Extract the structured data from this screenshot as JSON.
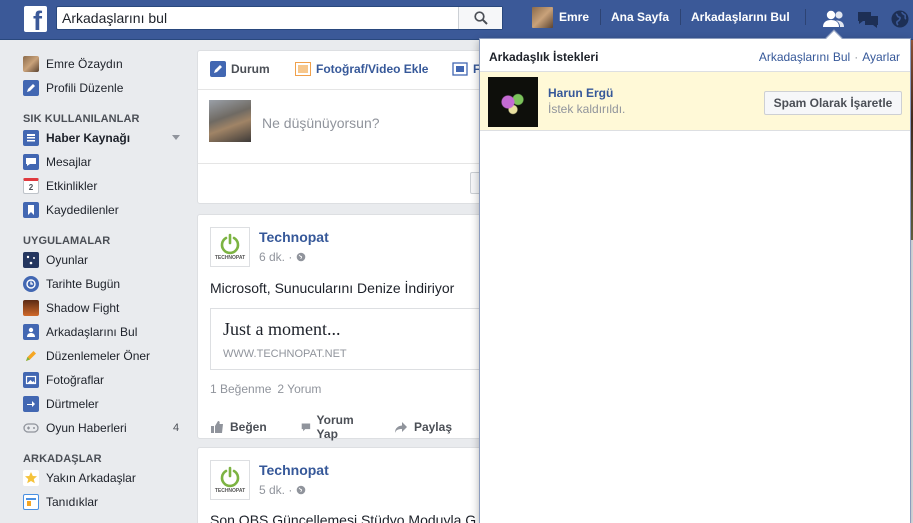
{
  "topbar": {
    "search_placeholder": "Arkadaşlarını bul",
    "search_value": "Arkadaşlarını bul",
    "user_name": "Emre",
    "home": "Ana Sayfa",
    "find_friends": "Arkadaşlarını Bul",
    "icons": [
      "search-icon",
      "friend-requests-icon",
      "messages-icon",
      "notifications-globe-icon"
    ]
  },
  "sidebar": {
    "profile_name": "Emre Özaydın",
    "edit_profile": "Profili Düzenle",
    "favorites_heading": "SIK KULLANILANLAR",
    "favorites": [
      "Haber Kaynağı",
      "Mesajlar",
      "Etkinlikler",
      "Kaydedilenler"
    ],
    "events_badge": "2",
    "apps_heading": "UYGULAMALAR",
    "apps": [
      "Oyunlar",
      "Tarihte Bugün",
      "Shadow Fight",
      "Arkadaşlarını Bul",
      "Düzenlemeler Öner",
      "Fotoğraflar",
      "Dürtmeler",
      "Oyun Haberleri"
    ],
    "game_news_count": "4",
    "friends_heading": "ARKADAŞLAR",
    "friends": [
      "Yakın Arkadaşlar",
      "Tanıdıklar"
    ]
  },
  "composer": {
    "tab_status": "Durum",
    "tab_photo": "Fotoğraf/Video Ekle",
    "tab_third": "F",
    "placeholder": "Ne düşünüyorsun?"
  },
  "posts": [
    {
      "page_name": "Technopat",
      "time": "6 dk. ·",
      "text": "Microsoft, Sunucularını Denize İndiriyor",
      "link_title": "Just a moment...",
      "link_url": "WWW.TECHNOPAT.NET",
      "likes": "1 Beğenme",
      "comments": "2 Yorum",
      "actions": [
        "Beğen",
        "Yorum Yap",
        "Paylaş"
      ]
    },
    {
      "page_name": "Technopat",
      "time": "5 dk. ·",
      "text": "Son OBS Güncellemesi Stüdyo Moduyla G"
    }
  ],
  "logo_text": "TECHNOPAT",
  "friend_requests": {
    "title": "Arkadaşlık İstekleri",
    "link_find": "Arkadaşlarını Bul",
    "link_separator": "·",
    "link_settings": "Ayarlar",
    "request": {
      "name": "Harun Ergü",
      "status": "İstek kaldırıldı.",
      "button": "Spam Olarak İşaretle"
    }
  },
  "colors": {
    "brand": "#3b5998",
    "link": "#365899",
    "request_highlight": "#fff9d7",
    "technopat_green": "#7cb342"
  }
}
